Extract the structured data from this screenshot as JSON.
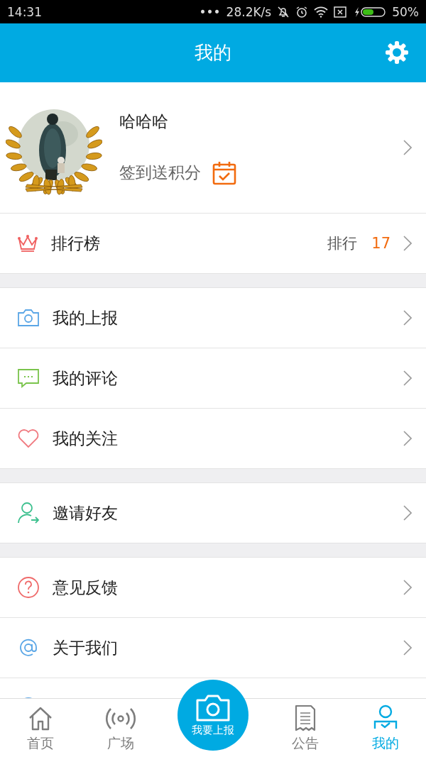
{
  "status_bar": {
    "time": "14:31",
    "dots": "•••",
    "speed": "28.2K/s",
    "battery": "50%"
  },
  "header": {
    "title": "我的"
  },
  "profile": {
    "name": "哈哈哈",
    "checkin": "签到送积分"
  },
  "sections": [
    {
      "items": [
        {
          "kind": "ranking",
          "label": "排行榜",
          "value_label": "排行",
          "value": "17"
        }
      ]
    },
    {
      "items": [
        {
          "kind": "camera",
          "label": "我的上报"
        },
        {
          "kind": "comment",
          "label": "我的评论"
        },
        {
          "kind": "heart",
          "label": "我的关注"
        }
      ]
    },
    {
      "items": [
        {
          "kind": "invite",
          "label": "邀请好友"
        }
      ]
    },
    {
      "items": [
        {
          "kind": "question",
          "label": "意见反馈"
        },
        {
          "kind": "at",
          "label": "关于我们"
        },
        {
          "kind": "partial"
        }
      ]
    }
  ],
  "tabs": [
    {
      "kind": "home",
      "label": "首页",
      "selected": false
    },
    {
      "kind": "broadcast",
      "label": "广场",
      "selected": false
    },
    {
      "kind": "center",
      "label": "我要上报",
      "selected": false
    },
    {
      "kind": "notice",
      "label": "公告",
      "selected": false
    },
    {
      "kind": "me",
      "label": "我的",
      "selected": true
    }
  ]
}
